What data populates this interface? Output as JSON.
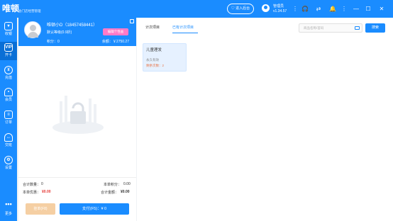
{
  "colors": {
    "accent": "#1a8cff",
    "edit_button": "#ff7ac8",
    "hold_button": "#f5cfa3",
    "red": "#e53935"
  },
  "header": {
    "logo": "唯顿",
    "slogan": "会门店经营管理",
    "trial_button": "♡ 进入后台",
    "admin_name": "管理员",
    "version": "v1.34.57",
    "icons": [
      "more-icon",
      "headset-icon",
      "switch-icon",
      "bell-icon",
      "more-icon",
      "minimize-icon",
      "maximize-icon",
      "close-icon"
    ]
  },
  "sidebar": {
    "items": [
      {
        "label": "收银",
        "icon": "cashier-icon"
      },
      {
        "label": "开卡",
        "icon": "vip-icon"
      },
      {
        "label": "充值",
        "icon": "recharge-icon"
      },
      {
        "label": "会员",
        "icon": "member-icon"
      },
      {
        "label": "订单",
        "icon": "order-icon"
      },
      {
        "label": "交班",
        "icon": "shift-icon"
      },
      {
        "label": "设置",
        "icon": "settings-icon"
      },
      {
        "label": "更多",
        "icon": "more-dots-icon"
      }
    ]
  },
  "member": {
    "name": "唯顿小D（18457458441）",
    "level": "默认等级(0.9折)",
    "edit_button": "编辑个性画",
    "points": "积分：0",
    "balance": "余额：￥2750.27"
  },
  "summary": {
    "count_label": "合计数量：",
    "count_value": "0",
    "points_label": "本单积分：",
    "points_value": "0.00",
    "discount_label": "本单优惠：",
    "discount_value": "¥0.00",
    "total_label": "合计金额：",
    "total_value": "¥0.00"
  },
  "buttons": {
    "hold": "挂单(F8)",
    "pay": "支付(F5)：¥ 0"
  },
  "right": {
    "tabs": [
      "计次项目",
      "已有计次项目"
    ],
    "search_placeholder": "商品名称/首码",
    "search_button": "搜索",
    "cards": [
      {
        "title": "儿童理发",
        "term": "永久有效",
        "remaining": "剩余次数：2"
      }
    ]
  }
}
